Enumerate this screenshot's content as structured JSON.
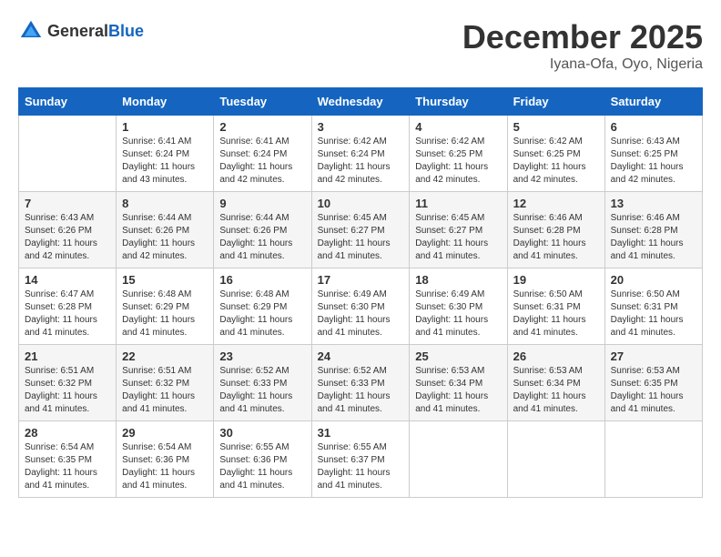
{
  "header": {
    "logo_general": "General",
    "logo_blue": "Blue",
    "month": "December 2025",
    "location": "Iyana-Ofa, Oyo, Nigeria"
  },
  "weekdays": [
    "Sunday",
    "Monday",
    "Tuesday",
    "Wednesday",
    "Thursday",
    "Friday",
    "Saturday"
  ],
  "weeks": [
    [
      {
        "day": "",
        "info": ""
      },
      {
        "day": "1",
        "info": "Sunrise: 6:41 AM\nSunset: 6:24 PM\nDaylight: 11 hours\nand 43 minutes."
      },
      {
        "day": "2",
        "info": "Sunrise: 6:41 AM\nSunset: 6:24 PM\nDaylight: 11 hours\nand 42 minutes."
      },
      {
        "day": "3",
        "info": "Sunrise: 6:42 AM\nSunset: 6:24 PM\nDaylight: 11 hours\nand 42 minutes."
      },
      {
        "day": "4",
        "info": "Sunrise: 6:42 AM\nSunset: 6:25 PM\nDaylight: 11 hours\nand 42 minutes."
      },
      {
        "day": "5",
        "info": "Sunrise: 6:42 AM\nSunset: 6:25 PM\nDaylight: 11 hours\nand 42 minutes."
      },
      {
        "day": "6",
        "info": "Sunrise: 6:43 AM\nSunset: 6:25 PM\nDaylight: 11 hours\nand 42 minutes."
      }
    ],
    [
      {
        "day": "7",
        "info": "Sunrise: 6:43 AM\nSunset: 6:26 PM\nDaylight: 11 hours\nand 42 minutes."
      },
      {
        "day": "8",
        "info": "Sunrise: 6:44 AM\nSunset: 6:26 PM\nDaylight: 11 hours\nand 42 minutes."
      },
      {
        "day": "9",
        "info": "Sunrise: 6:44 AM\nSunset: 6:26 PM\nDaylight: 11 hours\nand 41 minutes."
      },
      {
        "day": "10",
        "info": "Sunrise: 6:45 AM\nSunset: 6:27 PM\nDaylight: 11 hours\nand 41 minutes."
      },
      {
        "day": "11",
        "info": "Sunrise: 6:45 AM\nSunset: 6:27 PM\nDaylight: 11 hours\nand 41 minutes."
      },
      {
        "day": "12",
        "info": "Sunrise: 6:46 AM\nSunset: 6:28 PM\nDaylight: 11 hours\nand 41 minutes."
      },
      {
        "day": "13",
        "info": "Sunrise: 6:46 AM\nSunset: 6:28 PM\nDaylight: 11 hours\nand 41 minutes."
      }
    ],
    [
      {
        "day": "14",
        "info": "Sunrise: 6:47 AM\nSunset: 6:28 PM\nDaylight: 11 hours\nand 41 minutes."
      },
      {
        "day": "15",
        "info": "Sunrise: 6:48 AM\nSunset: 6:29 PM\nDaylight: 11 hours\nand 41 minutes."
      },
      {
        "day": "16",
        "info": "Sunrise: 6:48 AM\nSunset: 6:29 PM\nDaylight: 11 hours\nand 41 minutes."
      },
      {
        "day": "17",
        "info": "Sunrise: 6:49 AM\nSunset: 6:30 PM\nDaylight: 11 hours\nand 41 minutes."
      },
      {
        "day": "18",
        "info": "Sunrise: 6:49 AM\nSunset: 6:30 PM\nDaylight: 11 hours\nand 41 minutes."
      },
      {
        "day": "19",
        "info": "Sunrise: 6:50 AM\nSunset: 6:31 PM\nDaylight: 11 hours\nand 41 minutes."
      },
      {
        "day": "20",
        "info": "Sunrise: 6:50 AM\nSunset: 6:31 PM\nDaylight: 11 hours\nand 41 minutes."
      }
    ],
    [
      {
        "day": "21",
        "info": "Sunrise: 6:51 AM\nSunset: 6:32 PM\nDaylight: 11 hours\nand 41 minutes."
      },
      {
        "day": "22",
        "info": "Sunrise: 6:51 AM\nSunset: 6:32 PM\nDaylight: 11 hours\nand 41 minutes."
      },
      {
        "day": "23",
        "info": "Sunrise: 6:52 AM\nSunset: 6:33 PM\nDaylight: 11 hours\nand 41 minutes."
      },
      {
        "day": "24",
        "info": "Sunrise: 6:52 AM\nSunset: 6:33 PM\nDaylight: 11 hours\nand 41 minutes."
      },
      {
        "day": "25",
        "info": "Sunrise: 6:53 AM\nSunset: 6:34 PM\nDaylight: 11 hours\nand 41 minutes."
      },
      {
        "day": "26",
        "info": "Sunrise: 6:53 AM\nSunset: 6:34 PM\nDaylight: 11 hours\nand 41 minutes."
      },
      {
        "day": "27",
        "info": "Sunrise: 6:53 AM\nSunset: 6:35 PM\nDaylight: 11 hours\nand 41 minutes."
      }
    ],
    [
      {
        "day": "28",
        "info": "Sunrise: 6:54 AM\nSunset: 6:35 PM\nDaylight: 11 hours\nand 41 minutes."
      },
      {
        "day": "29",
        "info": "Sunrise: 6:54 AM\nSunset: 6:36 PM\nDaylight: 11 hours\nand 41 minutes."
      },
      {
        "day": "30",
        "info": "Sunrise: 6:55 AM\nSunset: 6:36 PM\nDaylight: 11 hours\nand 41 minutes."
      },
      {
        "day": "31",
        "info": "Sunrise: 6:55 AM\nSunset: 6:37 PM\nDaylight: 11 hours\nand 41 minutes."
      },
      {
        "day": "",
        "info": ""
      },
      {
        "day": "",
        "info": ""
      },
      {
        "day": "",
        "info": ""
      }
    ]
  ]
}
